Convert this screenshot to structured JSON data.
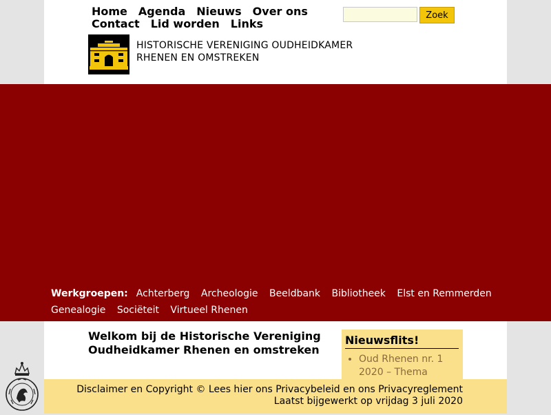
{
  "nav": {
    "items": [
      "Home",
      "Agenda",
      "Nieuws",
      "Over ons",
      "Contact",
      "Lid worden",
      "Links"
    ]
  },
  "search": {
    "button_label": "Zoek",
    "placeholder": ""
  },
  "org": {
    "line1": "HISTORISCHE VERENIGING OUDHEIDKAMER",
    "line2": "RHENEN EN OMSTREKEN"
  },
  "werkgroepen": {
    "label": "Werkgroepen:",
    "items": [
      "Achterberg",
      "Archeologie",
      "Beeldbank",
      "Bibliotheek",
      "Elst en Remmerden",
      "Genealogie",
      "Sociëteit",
      "Virtueel Rhenen"
    ]
  },
  "welcome": {
    "title": "Welkom bij de Historische Vereniging Oudheidkamer Rhenen en omstreken"
  },
  "news": {
    "title": "Nieuwsflits!",
    "items": [
      "Oud Rhenen nr. 1 2020 – Thema"
    ]
  },
  "footer": {
    "line1": "Disclaimer en Copyright © Lees hier ons Privacybeleid en ons Privacyreglement",
    "line2": "Laatst bijgewerkt op vrijdag 3 juli 2020"
  },
  "colors": {
    "hero": "#8b0000",
    "accent": "#f2c40a",
    "footer": "#fbe08c"
  },
  "icons": {
    "logo": "building-gate-icon",
    "seal": "royal-seal-icon"
  }
}
